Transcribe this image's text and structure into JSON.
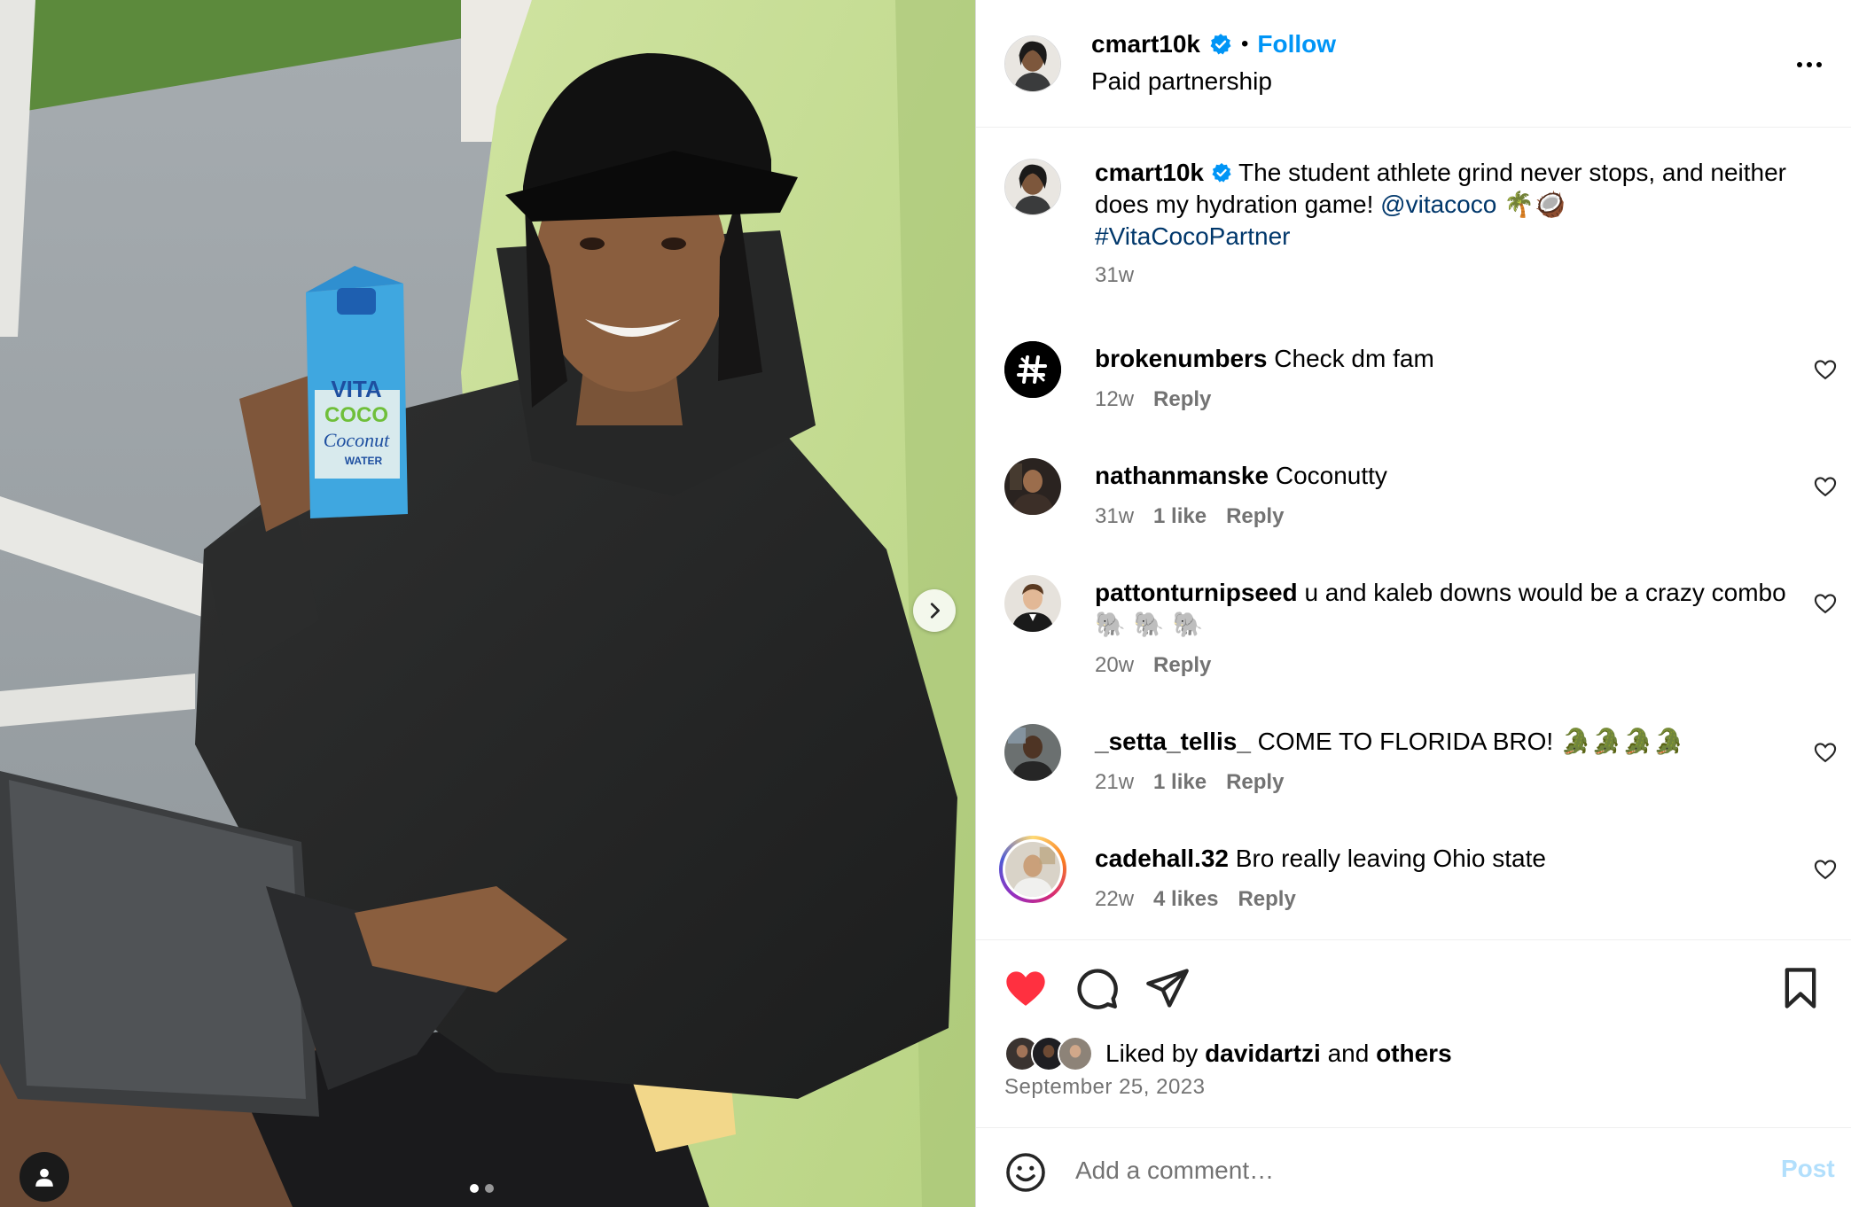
{
  "post": {
    "author": "cmart10k",
    "follow_label": "Follow",
    "separator": "•",
    "subtitle": "Paid partnership",
    "caption_text_1": "The student athlete grind never stops, and neither does my hydration game!",
    "caption_mention": "@vitacoco",
    "caption_emojis": "🌴🥥",
    "caption_hashtag": "#VitaCocoPartner",
    "caption_age": "31w",
    "product_text": {
      "brand_line1": "VITA",
      "brand_line2": "COCO",
      "product": "Coconut",
      "sub": "WATER"
    }
  },
  "comments": [
    {
      "username": "brokenumbers",
      "text": "Check dm fam",
      "age": "12w",
      "likes": "",
      "reply_label": "Reply",
      "avatar_icon": "hash-logo-icon"
    },
    {
      "username": "nathanmanske",
      "text": "Coconutty",
      "age": "31w",
      "likes": "1 like",
      "reply_label": "Reply",
      "avatar_icon": "user-photo"
    },
    {
      "username": "pattonturnipseed",
      "text": "u and kaleb downs would be a crazy combo",
      "emojis": "🐘 🐘 🐘",
      "age": "20w",
      "likes": "",
      "reply_label": "Reply",
      "avatar_icon": "user-photo"
    },
    {
      "username": "_setta_tellis_",
      "text": "COME TO FLORIDA BRO!",
      "emojis": "🐊🐊🐊🐊",
      "age": "21w",
      "likes": "1 like",
      "reply_label": "Reply",
      "avatar_icon": "user-photo"
    },
    {
      "username": "cadehall.32",
      "text": "Bro really leaving Ohio state",
      "age": "22w",
      "likes": "4 likes",
      "reply_label": "Reply",
      "avatar_icon": "story-ring-photo"
    }
  ],
  "actions": {
    "liked_by_prefix": "Liked by",
    "liked_by_user": "davidartzi",
    "liked_by_and": "and",
    "liked_by_others": "others",
    "date": "September 25, 2023",
    "liked": true
  },
  "composer": {
    "placeholder": "Add a comment…",
    "post_label": "Post"
  },
  "carousel": {
    "slide_count": 2,
    "active_slide": 1
  },
  "colors": {
    "accent": "#0095f6",
    "like_red": "#ff3040",
    "link_dark": "#00376b",
    "meta_gray": "#737373",
    "post_disabled": "#b2dffc"
  }
}
